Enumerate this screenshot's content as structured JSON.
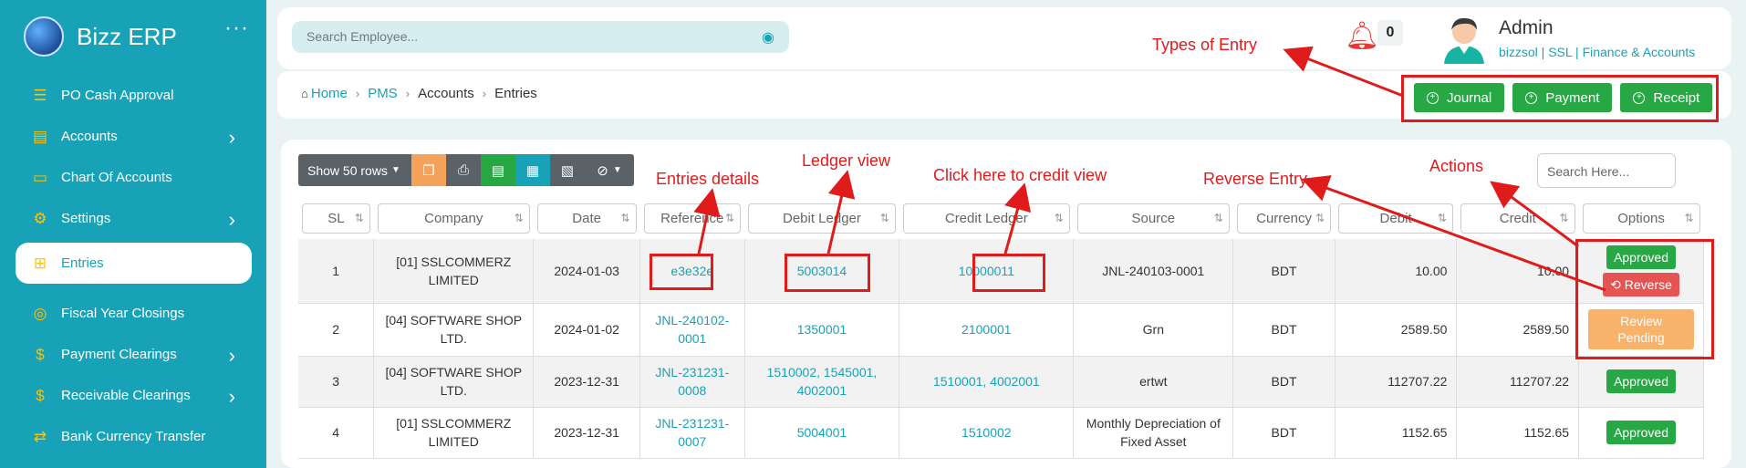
{
  "sidebar": {
    "brand": "Bizz ERP",
    "menu_dots": "···",
    "items": [
      {
        "label": "PO Cash Approval",
        "icon": "list-icon",
        "chevron": false
      },
      {
        "label": "Accounts",
        "icon": "clipboard-icon",
        "chevron": true
      },
      {
        "label": "Chart Of Accounts",
        "icon": "money-icon",
        "chevron": false
      },
      {
        "label": "Settings",
        "icon": "sitemap-icon",
        "chevron": true
      },
      {
        "label": "Entries",
        "icon": "plus-square-icon",
        "chevron": false,
        "active": true
      },
      {
        "label": "Fiscal Year Closings",
        "icon": "circle-icon",
        "chevron": false
      },
      {
        "label": "Payment Clearings",
        "icon": "file-dollar-icon",
        "chevron": true
      },
      {
        "label": "Receivable Clearings",
        "icon": "file-dollar-icon",
        "chevron": true
      },
      {
        "label": "Bank Currency Transfer",
        "icon": "shuffle-icon",
        "chevron": false
      }
    ]
  },
  "topbar": {
    "search_placeholder": "Search Employee...",
    "notification_count": "0",
    "user_name": "Admin",
    "user_sub": "bizzsol | SSL  | Finance & Accounts"
  },
  "breadcrumb": {
    "home": "Home",
    "pms": "PMS",
    "accounts": "Accounts",
    "current": "Entries"
  },
  "actions": {
    "journal": "Journal",
    "payment": "Payment",
    "receipt": "Receipt"
  },
  "toolbar": {
    "show_rows": "Show 50 rows",
    "search_placeholder": "Search Here..."
  },
  "table": {
    "headers": [
      "SL",
      "Company",
      "Date",
      "Reference",
      "Debit Ledger",
      "Credit Ledger",
      "Source",
      "Currency",
      "Debit",
      "Credit",
      "Options"
    ],
    "rows": [
      {
        "sl": "1",
        "company": "[01] SSLCOMMERZ LIMITED",
        "date": "2024-01-03",
        "reference": "e3e32e",
        "debit_ledger": "5003014",
        "credit_ledger": "10000011",
        "source": "JNL-240103-0001",
        "currency": "BDT",
        "debit": "10.00",
        "credit": "10.00",
        "status": "Approved",
        "reverse": "Reverse"
      },
      {
        "sl": "2",
        "company": "[04] SOFTWARE SHOP LTD.",
        "date": "2024-01-02",
        "reference": "JNL-240102-0001",
        "debit_ledger": "1350001",
        "credit_ledger": "2100001",
        "source": "Grn",
        "currency": "BDT",
        "debit": "2589.50",
        "credit": "2589.50",
        "status": "Review Pending"
      },
      {
        "sl": "3",
        "company": "[04] SOFTWARE SHOP LTD.",
        "date": "2023-12-31",
        "reference": "JNL-231231-0008",
        "debit_ledger": "1510002, 1545001, 4002001",
        "credit_ledger": "1510001, 4002001",
        "source": "ertwt",
        "currency": "BDT",
        "debit": "112707.22",
        "credit": "112707.22",
        "status": "Approved"
      },
      {
        "sl": "4",
        "company": "[01] SSLCOMMERZ LIMITED",
        "date": "2023-12-31",
        "reference": "JNL-231231-0007",
        "debit_ledger": "5004001",
        "credit_ledger": "1510002",
        "source": "Monthly Depreciation of Fixed Asset",
        "currency": "BDT",
        "debit": "1152.65",
        "credit": "1152.65",
        "status": "Approved"
      }
    ]
  },
  "annotations": {
    "types_of_entry": "Types of Entry",
    "entries_details": "Entries details",
    "ledger_view": "Ledger view",
    "credit_view": "Click here to credit view",
    "reverse_entry": "Reverse Entry",
    "actions": "Actions"
  },
  "colors": {
    "sidebar": "#17a2b8",
    "accent": "#17a2b8",
    "approved": "#28a745",
    "reverse": "#e55353",
    "pending": "#f9b26a",
    "annotation": "#e01b1b"
  }
}
